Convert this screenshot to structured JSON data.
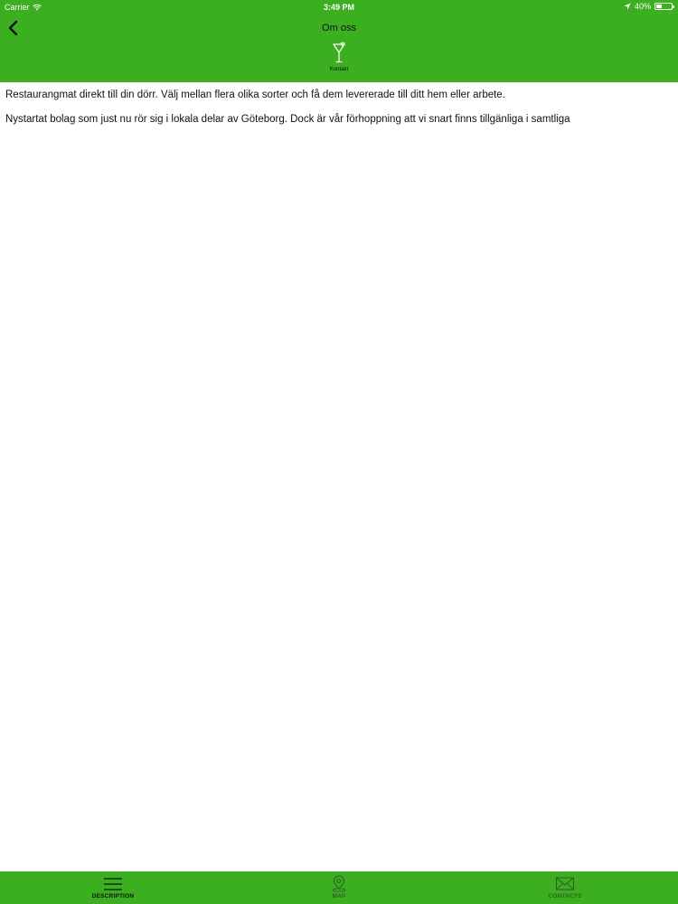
{
  "status_bar": {
    "carrier": "Carrier",
    "time": "3:49 PM",
    "battery_percent_label": "40%",
    "battery_level": 0.4
  },
  "nav": {
    "title": "Om oss",
    "back_icon": "chevron-left-icon",
    "contact_tab_label": "Kontakt",
    "contact_tab_icon": "cocktail-glass-icon"
  },
  "content": {
    "paragraphs": [
      "Restaurangmat direkt till din dörr. Välj mellan flera olika sorter och få dem levererade till ditt hem eller arbete.",
      "Nystartat bolag som just nu rör sig i lokala delar av Göteborg. Dock är vår förhoppning att vi snart finns tillgänliga i samtliga"
    ]
  },
  "tabbar": {
    "tabs": [
      {
        "label": "DESCRIPTION",
        "icon": "hamburger-menu-icon",
        "active": true
      },
      {
        "label": "MAP",
        "icon": "map-pin-icon",
        "active": false
      },
      {
        "label": "CONTACTS",
        "icon": "envelope-icon",
        "active": false
      }
    ]
  },
  "colors": {
    "accent_green": "#3baf1f",
    "text": "#111111",
    "inactive_tab_label": "#2f5f27"
  }
}
